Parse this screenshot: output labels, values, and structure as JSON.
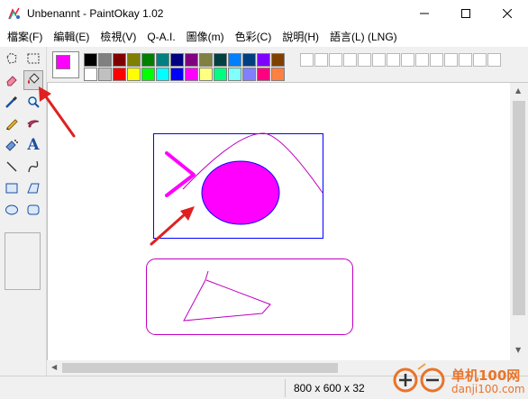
{
  "window": {
    "title": "Unbenannt - PaintOkay 1.02",
    "minimize_glyph": "—",
    "maximize_glyph": "☐",
    "close_glyph": "✕"
  },
  "menu": [
    "檔案(F)",
    "編輯(E)",
    "檢視(V)",
    "Q-A.I.",
    "圖像(m)",
    "色彩(C)",
    "說明(H)",
    "語言(L) (LNG)"
  ],
  "tools": [
    {
      "name": "free-select-icon",
      "active": false
    },
    {
      "name": "rect-select-icon",
      "active": false
    },
    {
      "name": "eraser-icon",
      "active": false
    },
    {
      "name": "fill-bucket-icon",
      "active": true
    },
    {
      "name": "color-picker-icon",
      "active": false
    },
    {
      "name": "magnifier-icon",
      "active": false
    },
    {
      "name": "pencil-icon",
      "active": false
    },
    {
      "name": "brush-icon",
      "active": false
    },
    {
      "name": "airbrush-icon",
      "active": false
    },
    {
      "name": "text-icon",
      "active": false
    },
    {
      "name": "line-icon",
      "active": false
    },
    {
      "name": "curve-icon",
      "active": false
    },
    {
      "name": "rectangle-icon",
      "active": false
    },
    {
      "name": "polygon-icon",
      "active": false
    },
    {
      "name": "ellipse-icon",
      "active": false
    },
    {
      "name": "rounded-rect-icon",
      "active": false
    }
  ],
  "text_tool_glyph": "A",
  "current_color": "#ff00ff",
  "palette": {
    "row1": [
      "#000000",
      "#808080",
      "#800000",
      "#808000",
      "#008000",
      "#008080",
      "#000080",
      "#800080",
      "#808040",
      "#004040",
      "#0080ff",
      "#004080",
      "#8000ff",
      "#804000"
    ],
    "row2": [
      "#ffffff",
      "#c0c0c0",
      "#ff0000",
      "#ffff00",
      "#00ff00",
      "#00ffff",
      "#0000ff",
      "#ff00ff",
      "#ffff80",
      "#00ff80",
      "#80ffff",
      "#8080ff",
      "#ff0080",
      "#ff8040"
    ],
    "custom_slots": 14
  },
  "status": {
    "dimensions": "800 x 600 x 32"
  },
  "watermark": {
    "title": "单机100网",
    "url": "danji100.com"
  },
  "colors": {
    "shape_magenta": "#ff00ff",
    "rect_blue": "#0000ff",
    "curve_purple": "#c000c0",
    "annotation_red": "#e02020"
  }
}
